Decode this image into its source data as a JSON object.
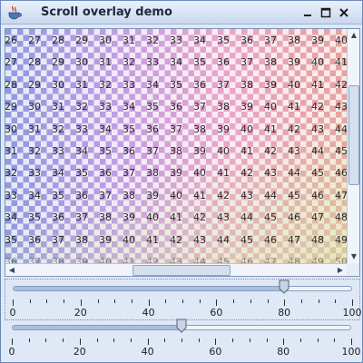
{
  "window": {
    "title": "Scroll overlay demo",
    "app_icon": "java-cup-icon",
    "controls": {
      "minimize": "minimize-icon",
      "maximize": "maximize-icon",
      "close": "close-icon"
    }
  },
  "grid": {
    "visible_rows": [
      [
        26,
        27,
        28,
        29,
        30,
        31,
        32,
        33,
        34,
        35,
        36,
        37,
        38,
        39,
        40,
        41
      ],
      [
        27,
        28,
        29,
        30,
        31,
        32,
        33,
        34,
        35,
        36,
        37,
        38,
        39,
        40,
        41,
        42
      ],
      [
        28,
        29,
        30,
        31,
        32,
        33,
        34,
        35,
        36,
        37,
        38,
        39,
        40,
        41,
        42,
        43
      ],
      [
        29,
        30,
        31,
        32,
        33,
        34,
        35,
        36,
        37,
        38,
        39,
        40,
        41,
        42,
        43,
        44
      ],
      [
        30,
        31,
        32,
        33,
        34,
        35,
        36,
        37,
        38,
        39,
        40,
        41,
        42,
        43,
        44,
        45
      ],
      [
        31,
        32,
        33,
        34,
        35,
        36,
        37,
        38,
        39,
        40,
        41,
        42,
        43,
        44,
        45,
        46
      ],
      [
        32,
        33,
        34,
        35,
        36,
        37,
        38,
        39,
        40,
        41,
        42,
        43,
        44,
        45,
        46,
        47
      ],
      [
        33,
        34,
        35,
        36,
        37,
        38,
        39,
        40,
        41,
        42,
        43,
        44,
        45,
        46,
        47,
        48
      ],
      [
        34,
        35,
        36,
        37,
        38,
        39,
        40,
        41,
        42,
        43,
        44,
        45,
        46,
        47,
        48,
        49
      ],
      [
        35,
        36,
        37,
        38,
        39,
        40,
        41,
        42,
        43,
        44,
        45,
        46,
        47,
        48,
        49,
        50
      ],
      [
        36,
        37,
        38,
        39,
        40,
        41,
        42,
        43,
        44,
        45,
        46,
        47,
        48,
        49,
        50,
        51
      ]
    ],
    "colors": {
      "left": "#8e9ae0",
      "mid": "#c59ee2",
      "pink": "#e9a6c9",
      "right": "#e6a39c",
      "corner": "#d2e6a0"
    }
  },
  "scrollbars": {
    "vertical": {
      "up_arrow": "arrow-up-icon",
      "down_arrow": "arrow-down-icon"
    },
    "horizontal": {
      "left_arrow": "arrow-left-icon",
      "right_arrow": "arrow-right-icon"
    }
  },
  "sliders": [
    {
      "name": "slider-1",
      "value": 80,
      "min": 0,
      "max": 100,
      "tick_labels": [
        "0",
        "20",
        "40",
        "60",
        "80",
        "100"
      ]
    },
    {
      "name": "slider-2",
      "value": 50,
      "min": 0,
      "max": 100,
      "tick_labels": [
        "0",
        "20",
        "40",
        "60",
        "80",
        "100"
      ]
    }
  ]
}
